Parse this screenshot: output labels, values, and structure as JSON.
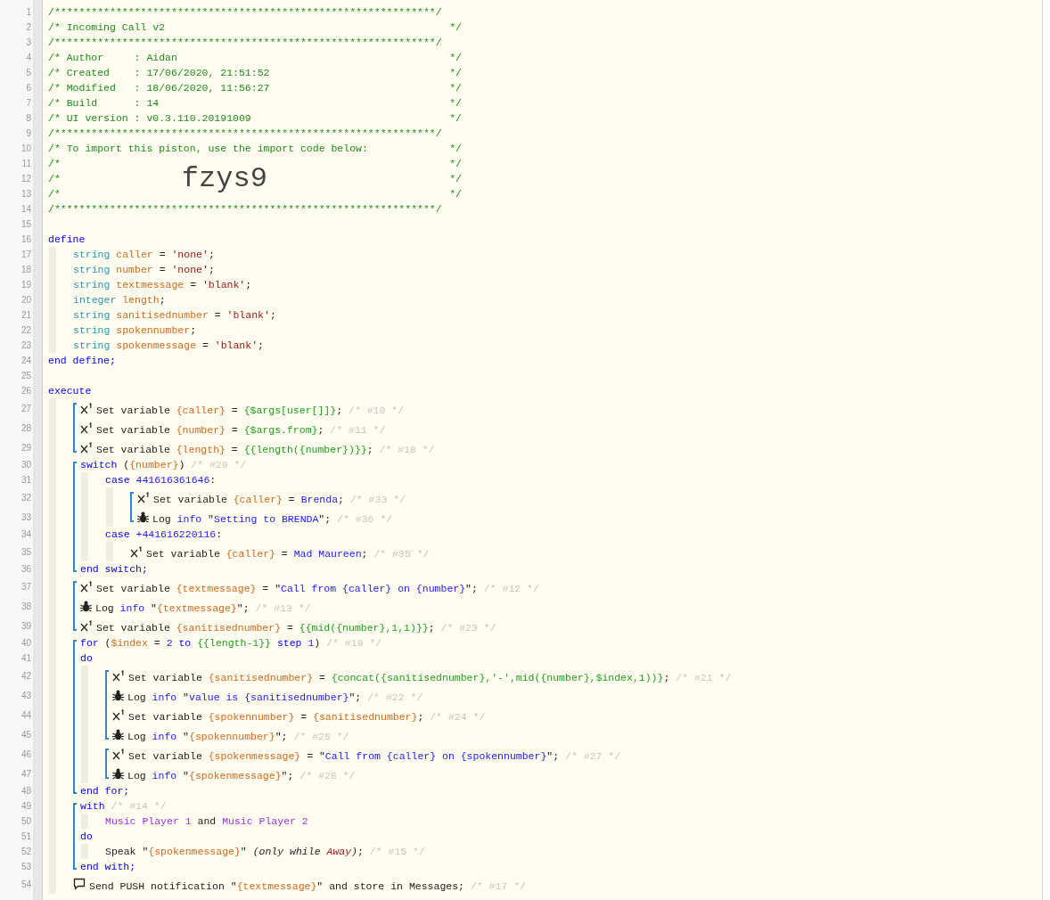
{
  "code": [
    {
      "kind": "line",
      "number": "1",
      "tokens": [
        {
          "kind": "c",
          "text": "/**************************************************************/"
        }
      ]
    },
    {
      "kind": "line",
      "number": "2",
      "tokens": [
        {
          "kind": "c",
          "text": "/* Incoming Call v2"
        },
        {
          "kind": "cr",
          "text": "*/"
        }
      ]
    },
    {
      "kind": "line",
      "number": "3",
      "tokens": [
        {
          "kind": "c",
          "text": "/**************************************************************/"
        }
      ]
    },
    {
      "kind": "line",
      "number": "4",
      "tokens": [
        {
          "kind": "c",
          "text": "/* Author     : Aidan"
        },
        {
          "kind": "cr",
          "text": "*/"
        }
      ]
    },
    {
      "kind": "line",
      "number": "5",
      "tokens": [
        {
          "kind": "c",
          "text": "/* Created    : 17/06/2020, 21:51:52"
        },
        {
          "kind": "cr",
          "text": "*/"
        }
      ]
    },
    {
      "kind": "line",
      "number": "6",
      "tokens": [
        {
          "kind": "c",
          "text": "/* Modified   : 18/06/2020, 11:56:27"
        },
        {
          "kind": "cr",
          "text": "*/"
        }
      ]
    },
    {
      "kind": "line",
      "number": "7",
      "tokens": [
        {
          "kind": "c",
          "text": "/* Build      : 14"
        },
        {
          "kind": "cr",
          "text": "*/"
        }
      ]
    },
    {
      "kind": "line",
      "number": "8",
      "tokens": [
        {
          "kind": "c",
          "text": "/* UI version : v0.3.110.20191009"
        },
        {
          "kind": "cr",
          "text": "*/"
        }
      ]
    },
    {
      "kind": "line",
      "number": "9",
      "tokens": [
        {
          "kind": "c",
          "text": "/**************************************************************/"
        }
      ]
    },
    {
      "kind": "line",
      "number": "10",
      "tokens": [
        {
          "kind": "c",
          "text": "/* To import this piston, use the import code below:"
        },
        {
          "kind": "cr",
          "text": "*/"
        }
      ]
    },
    {
      "kind": "line",
      "number": "11",
      "tokens": [
        {
          "kind": "c",
          "text": "/*"
        },
        {
          "kind": "cr",
          "text": "*/"
        }
      ]
    },
    {
      "kind": "line",
      "number": "12",
      "tokens": [
        {
          "kind": "c",
          "text": "/*"
        },
        {
          "kind": "big",
          "text": "fzys9"
        },
        {
          "kind": "cr",
          "text": "*/"
        }
      ]
    },
    {
      "kind": "line",
      "number": "13",
      "tokens": [
        {
          "kind": "c",
          "text": "/*"
        },
        {
          "kind": "cr",
          "text": "*/"
        }
      ]
    },
    {
      "kind": "line",
      "number": "14",
      "tokens": [
        {
          "kind": "c",
          "text": "/**************************************************************/"
        }
      ]
    },
    {
      "kind": "line",
      "number": "15"
    },
    {
      "kind": "line",
      "number": "16",
      "tokens": [
        {
          "kind": "kw",
          "text": "define"
        }
      ],
      "children": [
        {
          "kind": "line",
          "number": "17",
          "tokens": [
            {
              "kind": "ty",
              "text": "string "
            },
            {
              "kind": "v",
              "text": "caller"
            },
            {
              "kind": "p",
              "text": " = "
            },
            {
              "kind": "s",
              "text": "'none'"
            },
            {
              "kind": "p",
              "text": ";"
            }
          ]
        },
        {
          "kind": "line",
          "number": "18",
          "tokens": [
            {
              "kind": "ty",
              "text": "string "
            },
            {
              "kind": "v",
              "text": "number"
            },
            {
              "kind": "p",
              "text": " = "
            },
            {
              "kind": "s",
              "text": "'none'"
            },
            {
              "kind": "p",
              "text": ";"
            }
          ]
        },
        {
          "kind": "line",
          "number": "19",
          "tokens": [
            {
              "kind": "ty",
              "text": "string "
            },
            {
              "kind": "v",
              "text": "textmessage"
            },
            {
              "kind": "p",
              "text": " = "
            },
            {
              "kind": "s",
              "text": "'blank'"
            },
            {
              "kind": "p",
              "text": ";"
            }
          ]
        },
        {
          "kind": "line",
          "number": "20",
          "tokens": [
            {
              "kind": "ty",
              "text": "integer "
            },
            {
              "kind": "v",
              "text": "length"
            },
            {
              "kind": "p",
              "text": ";"
            }
          ]
        },
        {
          "kind": "line",
          "number": "21",
          "tokens": [
            {
              "kind": "ty",
              "text": "string "
            },
            {
              "kind": "v",
              "text": "sanitisednumber"
            },
            {
              "kind": "p",
              "text": " = "
            },
            {
              "kind": "s",
              "text": "'blank'"
            },
            {
              "kind": "p",
              "text": ";"
            }
          ]
        },
        {
          "kind": "line",
          "number": "22",
          "tokens": [
            {
              "kind": "ty",
              "text": "string "
            },
            {
              "kind": "v",
              "text": "spokennumber"
            },
            {
              "kind": "p",
              "text": ";"
            }
          ]
        },
        {
          "kind": "line",
          "number": "23",
          "tokens": [
            {
              "kind": "ty",
              "text": "string "
            },
            {
              "kind": "v",
              "text": "spokenmessage"
            },
            {
              "kind": "p",
              "text": " = "
            },
            {
              "kind": "s",
              "text": "'blank'"
            },
            {
              "kind": "p",
              "text": ";"
            }
          ]
        }
      ]
    },
    {
      "kind": "line",
      "number": "24",
      "tokens": [
        {
          "kind": "kw",
          "text": "end define;"
        }
      ]
    },
    {
      "kind": "line",
      "number": "25"
    },
    {
      "kind": "line",
      "number": "26",
      "tokens": [
        {
          "kind": "kw",
          "text": "execute"
        }
      ],
      "children": [
        {
          "kind": "bracket",
          "children": [
            {
              "kind": "set_variable",
              "number": "27",
              "tokens": [
                {
                  "kind": "p",
                  "text": "Set variable "
                },
                {
                  "kind": "v",
                  "text": "{caller}"
                },
                {
                  "kind": "p",
                  "text": " = "
                },
                {
                  "kind": "e",
                  "text": "{$args[user[]]}"
                },
                {
                  "kind": "p",
                  "text": "; "
                },
                {
                  "kind": "n",
                  "text": "/* #10 */"
                }
              ]
            },
            {
              "kind": "set_variable",
              "number": "28",
              "tokens": [
                {
                  "kind": "p",
                  "text": "Set variable "
                },
                {
                  "kind": "v",
                  "text": "{number}"
                },
                {
                  "kind": "p",
                  "text": " = "
                },
                {
                  "kind": "e",
                  "text": "{$args.from}"
                },
                {
                  "kind": "p",
                  "text": "; "
                },
                {
                  "kind": "n",
                  "text": "/* #11 */"
                }
              ]
            },
            {
              "kind": "set_variable",
              "number": "29",
              "tokens": [
                {
                  "kind": "p",
                  "text": "Set variable "
                },
                {
                  "kind": "v",
                  "text": "{length}"
                },
                {
                  "kind": "p",
                  "text": " = "
                },
                {
                  "kind": "e",
                  "text": "{{length({number})}}"
                },
                {
                  "kind": "p",
                  "text": "; "
                },
                {
                  "kind": "n",
                  "text": "/* #18 */"
                }
              ]
            }
          ]
        },
        {
          "kind": "bracket",
          "children": [
            {
              "kind": "line",
              "number": "30",
              "tokens": [
                {
                  "kind": "kw",
                  "text": "switch "
                },
                {
                  "kind": "p",
                  "text": "("
                },
                {
                  "kind": "v",
                  "text": "{number}"
                },
                {
                  "kind": "p",
                  "text": ") "
                },
                {
                  "kind": "n",
                  "text": "/* #29 */"
                }
              ],
              "children": [
                {
                  "kind": "line",
                  "number": "31",
                  "tokens": [
                    {
                      "kind": "kw",
                      "text": "case "
                    },
                    {
                      "kind": "t",
                      "text": "441616361646"
                    },
                    {
                      "kind": "p",
                      "text": ":"
                    }
                  ],
                  "children": [
                    {
                      "kind": "bracket",
                      "children": [
                        {
                          "kind": "set_variable",
                          "number": "32",
                          "tokens": [
                            {
                              "kind": "p",
                              "text": "Set variable "
                            },
                            {
                              "kind": "v",
                              "text": "{caller}"
                            },
                            {
                              "kind": "p",
                              "text": " = "
                            },
                            {
                              "kind": "t",
                              "text": "Brenda"
                            },
                            {
                              "kind": "p",
                              "text": "; "
                            },
                            {
                              "kind": "n",
                              "text": "/* #33 */"
                            }
                          ]
                        },
                        {
                          "kind": "log",
                          "number": "33",
                          "tokens": [
                            {
                              "kind": "p",
                              "text": "Log "
                            },
                            {
                              "kind": "t",
                              "text": "info"
                            },
                            {
                              "kind": "p",
                              "text": " \""
                            },
                            {
                              "kind": "t",
                              "text": "Setting to BRENDA"
                            },
                            {
                              "kind": "p",
                              "text": "\"; "
                            },
                            {
                              "kind": "n",
                              "text": "/* #36 */"
                            }
                          ]
                        }
                      ]
                    }
                  ]
                },
                {
                  "kind": "line",
                  "number": "34",
                  "tokens": [
                    {
                      "kind": "kw",
                      "text": "case "
                    },
                    {
                      "kind": "t",
                      "text": "+441616220116"
                    },
                    {
                      "kind": "p",
                      "text": ":"
                    }
                  ],
                  "children": [
                    {
                      "kind": "set_variable",
                      "number": "35",
                      "tokens": [
                        {
                          "kind": "p",
                          "text": "Set variable "
                        },
                        {
                          "kind": "v",
                          "text": "{caller}"
                        },
                        {
                          "kind": "p",
                          "text": " = "
                        },
                        {
                          "kind": "t",
                          "text": "Mad Maureen"
                        },
                        {
                          "kind": "p",
                          "text": "; "
                        },
                        {
                          "kind": "n",
                          "text": "/* #35 */"
                        }
                      ]
                    }
                  ]
                }
              ]
            },
            {
              "kind": "line",
              "number": "36",
              "tokens": [
                {
                  "kind": "kw",
                  "text": "end switch;"
                }
              ]
            }
          ]
        },
        {
          "kind": "bracket",
          "children": [
            {
              "kind": "set_variable",
              "number": "37",
              "tokens": [
                {
                  "kind": "p",
                  "text": "Set variable "
                },
                {
                  "kind": "v",
                  "text": "{textmessage}"
                },
                {
                  "kind": "p",
                  "text": " = \""
                },
                {
                  "kind": "t",
                  "text": "Call from {caller} on {number}"
                },
                {
                  "kind": "p",
                  "text": "\"; "
                },
                {
                  "kind": "n",
                  "text": "/* #12 */"
                }
              ]
            },
            {
              "kind": "log",
              "number": "38",
              "tokens": [
                {
                  "kind": "p",
                  "text": "Log "
                },
                {
                  "kind": "t",
                  "text": "info"
                },
                {
                  "kind": "p",
                  "text": " \""
                },
                {
                  "kind": "v",
                  "text": "{textmessage}"
                },
                {
                  "kind": "p",
                  "text": "\"; "
                },
                {
                  "kind": "n",
                  "text": "/* #13 */"
                }
              ]
            },
            {
              "kind": "set_variable",
              "number": "39",
              "tokens": [
                {
                  "kind": "p",
                  "text": "Set variable "
                },
                {
                  "kind": "v",
                  "text": "{sanitisednumber}"
                },
                {
                  "kind": "p",
                  "text": " = "
                },
                {
                  "kind": "e",
                  "text": "{{mid({number},1,1)}}"
                },
                {
                  "kind": "p",
                  "text": "; "
                },
                {
                  "kind": "n",
                  "text": "/* #23 */"
                }
              ]
            }
          ]
        },
        {
          "kind": "bracket",
          "children": [
            {
              "kind": "line",
              "number": "40",
              "tokens": [
                {
                  "kind": "kw",
                  "text": "for "
                },
                {
                  "kind": "p",
                  "text": "("
                },
                {
                  "kind": "v",
                  "text": "$index"
                },
                {
                  "kind": "p",
                  "text": " = "
                },
                {
                  "kind": "t",
                  "text": "2"
                },
                {
                  "kind": "kw",
                  "text": " to "
                },
                {
                  "kind": "e",
                  "text": "{{length-1}}"
                },
                {
                  "kind": "kw",
                  "text": " step "
                },
                {
                  "kind": "t",
                  "text": "1"
                },
                {
                  "kind": "p",
                  "text": ") "
                },
                {
                  "kind": "n",
                  "text": "/* #19 */"
                }
              ]
            },
            {
              "kind": "line",
              "number": "41",
              "tokens": [
                {
                  "kind": "kw",
                  "text": "do"
                }
              ],
              "children": [
                {
                  "kind": "bracket",
                  "children": [
                    {
                      "kind": "set_variable",
                      "number": "42",
                      "tokens": [
                        {
                          "kind": "p",
                          "text": "Set variable "
                        },
                        {
                          "kind": "v",
                          "text": "{sanitisednumber}"
                        },
                        {
                          "kind": "p",
                          "text": " = "
                        },
                        {
                          "kind": "e",
                          "text": "{concat({sanitisednumber},'-',mid({number},$index,1))}"
                        },
                        {
                          "kind": "p",
                          "text": "; "
                        },
                        {
                          "kind": "n",
                          "text": "/* #21 */"
                        }
                      ]
                    },
                    {
                      "kind": "log",
                      "number": "43",
                      "tokens": [
                        {
                          "kind": "p",
                          "text": "Log "
                        },
                        {
                          "kind": "t",
                          "text": "info"
                        },
                        {
                          "kind": "p",
                          "text": " \""
                        },
                        {
                          "kind": "t",
                          "text": "value is {sanitisednumber}"
                        },
                        {
                          "kind": "p",
                          "text": "\"; "
                        },
                        {
                          "kind": "n",
                          "text": "/* #22 */"
                        }
                      ]
                    },
                    {
                      "kind": "set_variable",
                      "number": "44",
                      "tokens": [
                        {
                          "kind": "p",
                          "text": "Set variable "
                        },
                        {
                          "kind": "v",
                          "text": "{spokennumber}"
                        },
                        {
                          "kind": "p",
                          "text": " = "
                        },
                        {
                          "kind": "v",
                          "text": "{sanitisednumber}"
                        },
                        {
                          "kind": "p",
                          "text": "; "
                        },
                        {
                          "kind": "n",
                          "text": "/* #24 */"
                        }
                      ]
                    },
                    {
                      "kind": "log",
                      "number": "45",
                      "tokens": [
                        {
                          "kind": "p",
                          "text": "Log "
                        },
                        {
                          "kind": "t",
                          "text": "info"
                        },
                        {
                          "kind": "p",
                          "text": " \""
                        },
                        {
                          "kind": "v",
                          "text": "{spokennumber}"
                        },
                        {
                          "kind": "p",
                          "text": "\"; "
                        },
                        {
                          "kind": "n",
                          "text": "/* #25 */"
                        }
                      ]
                    }
                  ]
                },
                {
                  "kind": "bracket",
                  "children": [
                    {
                      "kind": "set_variable",
                      "number": "46",
                      "tokens": [
                        {
                          "kind": "p",
                          "text": "Set variable "
                        },
                        {
                          "kind": "v",
                          "text": "{spokenmessage}"
                        },
                        {
                          "kind": "p",
                          "text": " = \""
                        },
                        {
                          "kind": "t",
                          "text": "Call from {caller} on {spokennumber}"
                        },
                        {
                          "kind": "p",
                          "text": "\"; "
                        },
                        {
                          "kind": "n",
                          "text": "/* #27 */"
                        }
                      ]
                    },
                    {
                      "kind": "log",
                      "number": "47",
                      "tokens": [
                        {
                          "kind": "p",
                          "text": "Log "
                        },
                        {
                          "kind": "t",
                          "text": "info"
                        },
                        {
                          "kind": "p",
                          "text": " \""
                        },
                        {
                          "kind": "v",
                          "text": "{spokenmessage}"
                        },
                        {
                          "kind": "p",
                          "text": "\"; "
                        },
                        {
                          "kind": "n",
                          "text": "/* #28 */"
                        }
                      ]
                    }
                  ]
                }
              ]
            },
            {
              "kind": "line",
              "number": "48",
              "tokens": [
                {
                  "kind": "kw",
                  "text": "end for;"
                }
              ]
            }
          ]
        },
        {
          "kind": "bracket",
          "children": [
            {
              "kind": "line",
              "number": "49",
              "tokens": [
                {
                  "kind": "kw",
                  "text": "with "
                },
                {
                  "kind": "n",
                  "text": "/* #14 */"
                }
              ],
              "children": [
                {
                  "kind": "line",
                  "number": "50",
                  "tokens": [
                    {
                      "kind": "d",
                      "text": "Music Player 1"
                    },
                    {
                      "kind": "p",
                      "text": " and "
                    },
                    {
                      "kind": "d",
                      "text": "Music Player 2"
                    }
                  ]
                }
              ]
            },
            {
              "kind": "line",
              "number": "51",
              "tokens": [
                {
                  "kind": "kw",
                  "text": "do"
                }
              ],
              "children": [
                {
                  "kind": "line",
                  "number": "52",
                  "tokens": [
                    {
                      "kind": "p",
                      "text": "Speak \""
                    },
                    {
                      "kind": "v",
                      "text": "{spokenmessage}"
                    },
                    {
                      "kind": "p",
                      "text": "\" "
                    },
                    {
                      "kind": "i",
                      "text": "(only while "
                    },
                    {
                      "kind": "ir",
                      "text": "Away"
                    },
                    {
                      "kind": "i",
                      "text": ")"
                    },
                    {
                      "kind": "p",
                      "text": "; "
                    },
                    {
                      "kind": "n",
                      "text": "/* #15 */"
                    }
                  ]
                }
              ]
            },
            {
              "kind": "line",
              "number": "53",
              "tokens": [
                {
                  "kind": "kw",
                  "text": "end with;"
                }
              ]
            }
          ]
        },
        {
          "kind": "notification",
          "number": "54",
          "tokens": [
            {
              "kind": "p",
              "text": "Send PUSH notification \""
            },
            {
              "kind": "v",
              "text": "{textmessage}"
            },
            {
              "kind": "p",
              "text": "\" and store in Messages; "
            },
            {
              "kind": "n",
              "text": "/* #17 */"
            }
          ]
        }
      ]
    }
  ]
}
